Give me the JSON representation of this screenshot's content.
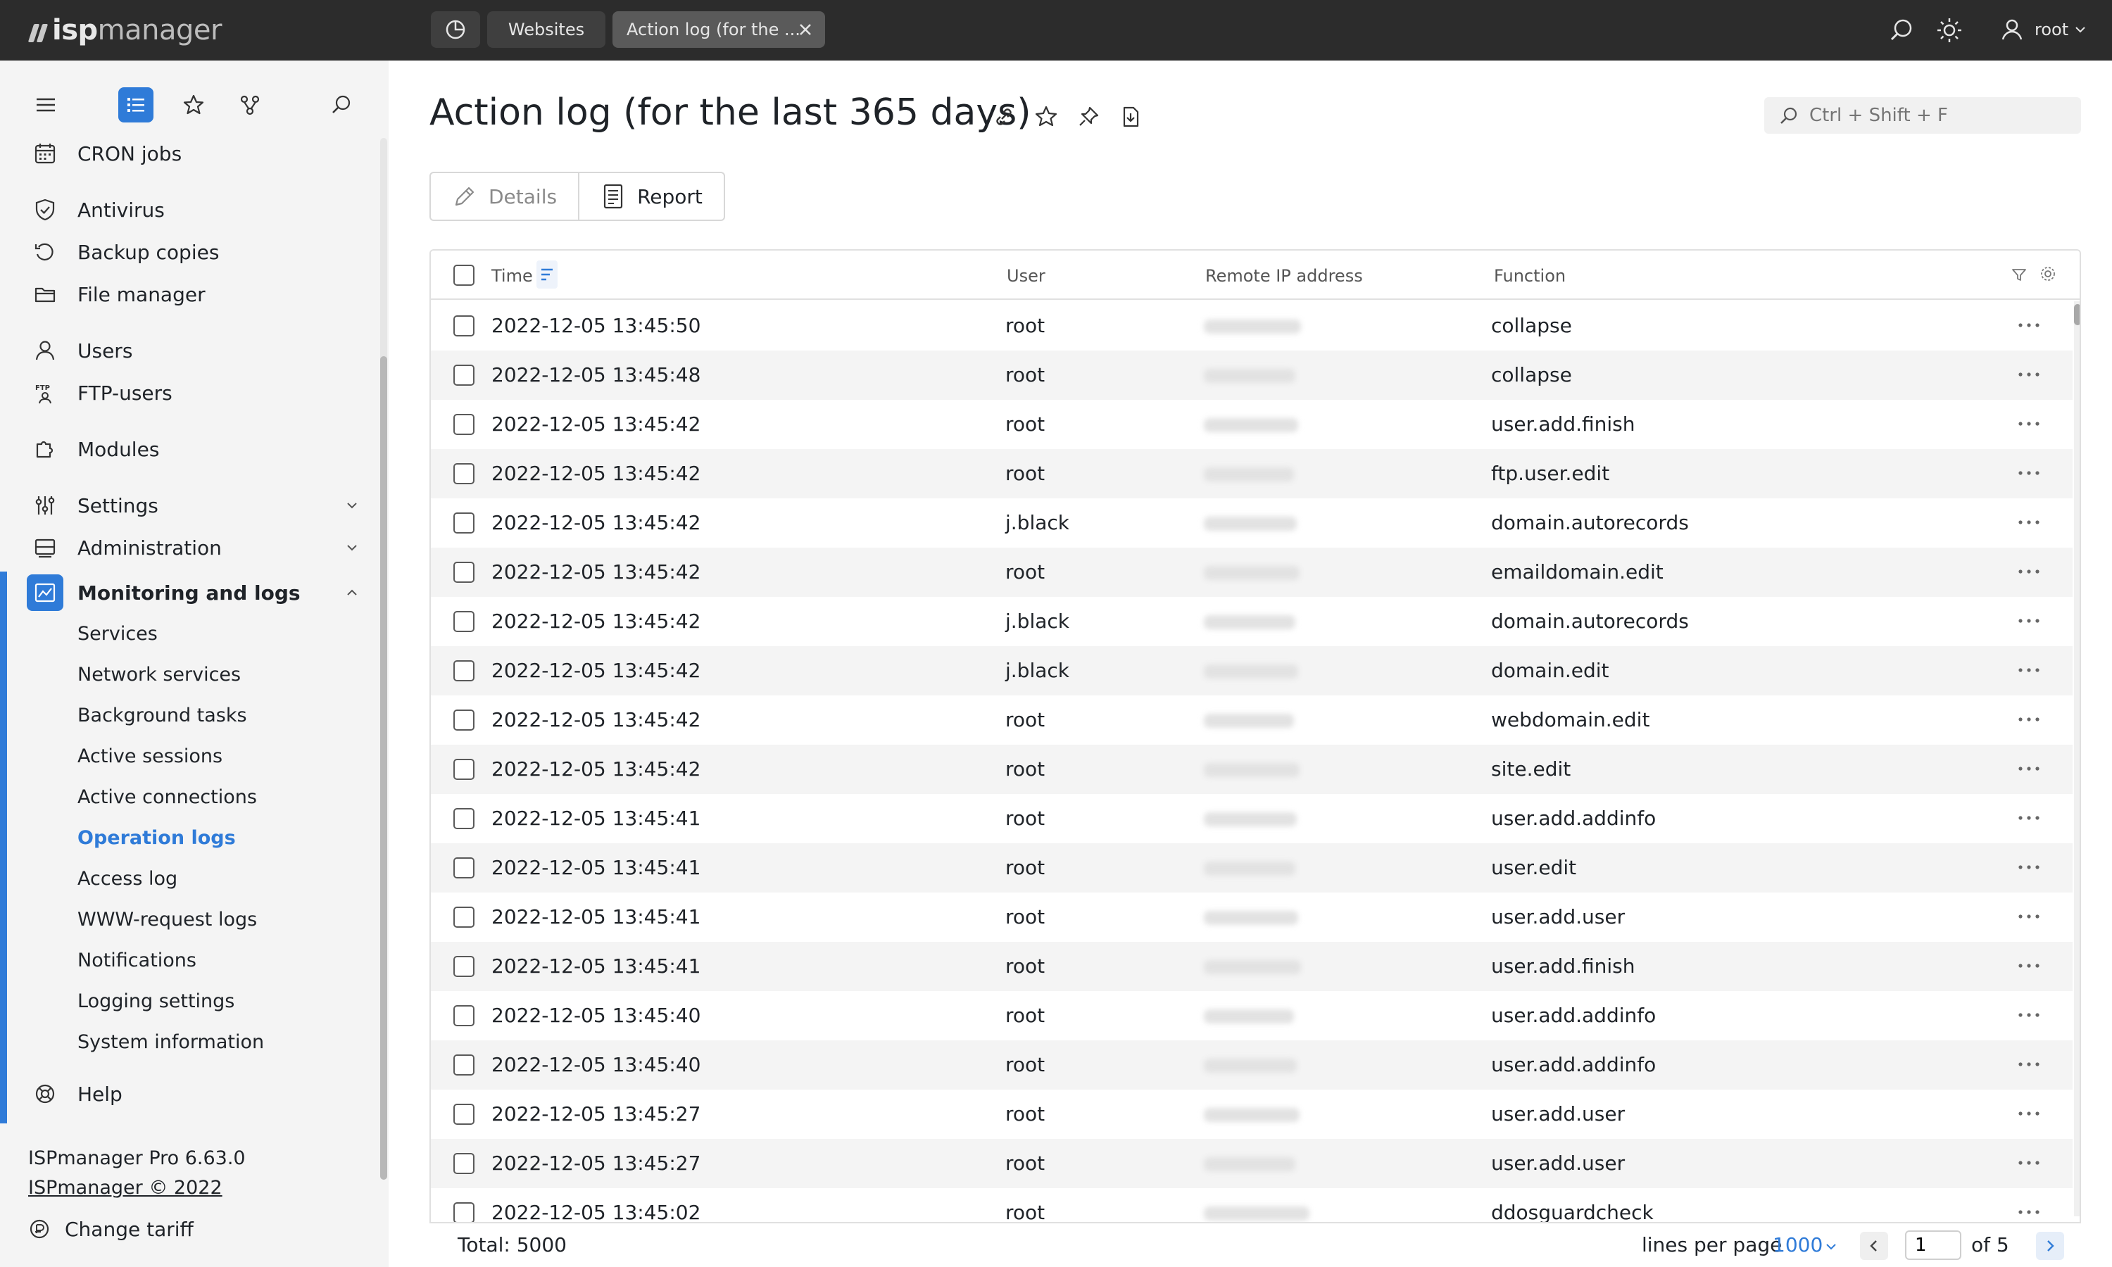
{
  "topbar": {
    "logo_isp": "isp",
    "logo_manager": "manager",
    "tabs": [
      {
        "label": "Websites"
      },
      {
        "label": "Action log (for the ..."
      }
    ],
    "user": "root"
  },
  "sidebar": {
    "items": [
      {
        "label": "CRON jobs",
        "icon": "calendar-icon"
      },
      {
        "label": "Antivirus",
        "icon": "shield-icon"
      },
      {
        "label": "Backup copies",
        "icon": "backup-icon"
      },
      {
        "label": "File manager",
        "icon": "folder-icon"
      },
      {
        "label": "Users",
        "icon": "user-icon"
      },
      {
        "label": "FTP-users",
        "icon": "ftp-icon"
      },
      {
        "label": "Modules",
        "icon": "puzzle-icon"
      },
      {
        "label": "Settings",
        "icon": "sliders-icon"
      },
      {
        "label": "Administration",
        "icon": "server-icon"
      },
      {
        "label": "Monitoring and logs",
        "icon": "chart-icon"
      }
    ],
    "subitems": [
      {
        "label": "Services"
      },
      {
        "label": "Network services"
      },
      {
        "label": "Background tasks"
      },
      {
        "label": "Active sessions"
      },
      {
        "label": "Active connections"
      },
      {
        "label": "Operation logs"
      },
      {
        "label": "Access log"
      },
      {
        "label": "WWW-request logs"
      },
      {
        "label": "Notifications"
      },
      {
        "label": "Logging settings"
      },
      {
        "label": "System information"
      }
    ],
    "help": "Help",
    "version": "ISPmanager Pro 6.63.0",
    "copyright": "ISPmanager © 2022",
    "change_tariff": "Change tariff"
  },
  "main": {
    "title": "Action log (for the last 365 days)",
    "search_placeholder": "Ctrl + Shift + F",
    "toolbar": {
      "details": "Details",
      "report": "Report"
    },
    "columns": {
      "time": "Time",
      "user": "User",
      "ip": "Remote IP address",
      "function": "Function"
    },
    "rows": [
      {
        "time": "2022-12-05 13:45:50",
        "user": "root",
        "function": "collapse"
      },
      {
        "time": "2022-12-05 13:45:48",
        "user": "root",
        "function": "collapse"
      },
      {
        "time": "2022-12-05 13:45:42",
        "user": "root",
        "function": "user.add.finish"
      },
      {
        "time": "2022-12-05 13:45:42",
        "user": "root",
        "function": "ftp.user.edit"
      },
      {
        "time": "2022-12-05 13:45:42",
        "user": "j.black",
        "function": "domain.autorecords"
      },
      {
        "time": "2022-12-05 13:45:42",
        "user": "root",
        "function": "emaildomain.edit"
      },
      {
        "time": "2022-12-05 13:45:42",
        "user": "j.black",
        "function": "domain.autorecords"
      },
      {
        "time": "2022-12-05 13:45:42",
        "user": "j.black",
        "function": "domain.edit"
      },
      {
        "time": "2022-12-05 13:45:42",
        "user": "root",
        "function": "webdomain.edit"
      },
      {
        "time": "2022-12-05 13:45:42",
        "user": "root",
        "function": "site.edit"
      },
      {
        "time": "2022-12-05 13:45:41",
        "user": "root",
        "function": "user.add.addinfo"
      },
      {
        "time": "2022-12-05 13:45:41",
        "user": "root",
        "function": "user.edit"
      },
      {
        "time": "2022-12-05 13:45:41",
        "user": "root",
        "function": "user.add.user"
      },
      {
        "time": "2022-12-05 13:45:41",
        "user": "root",
        "function": "user.add.finish"
      },
      {
        "time": "2022-12-05 13:45:40",
        "user": "root",
        "function": "user.add.addinfo"
      },
      {
        "time": "2022-12-05 13:45:40",
        "user": "root",
        "function": "user.add.addinfo"
      },
      {
        "time": "2022-12-05 13:45:27",
        "user": "root",
        "function": "user.add.user"
      },
      {
        "time": "2022-12-05 13:45:27",
        "user": "root",
        "function": "user.add.user"
      },
      {
        "time": "2022-12-05 13:45:02",
        "user": "root",
        "function": "ddosguardcheck"
      }
    ],
    "footer": {
      "total": "Total: 5000",
      "lines_per_page_label": "lines per page",
      "lines_per_page": "1000",
      "page": "1",
      "of": "of 5"
    }
  },
  "colors": {
    "accent": "#2f7bd8",
    "topbar": "#2c2c2c",
    "sidebar": "#f4f4f4"
  }
}
